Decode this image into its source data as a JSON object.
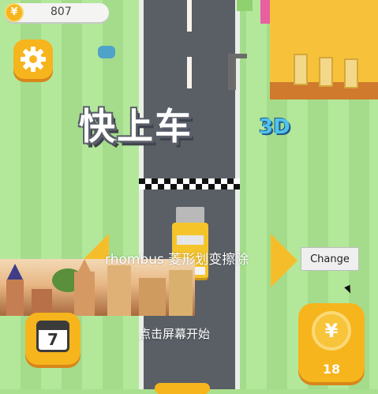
{
  "hud": {
    "coin_symbol": "¥",
    "coin_count": "807"
  },
  "title": {
    "main": "快上车",
    "suffix": "3D"
  },
  "overlay": {
    "caption": "rhombus 菱形划变擦除",
    "change_label": "Change"
  },
  "bottom": {
    "calendar_day": "7",
    "start_hint": "点击屏幕开始",
    "coin_symbol": "¥",
    "coin_reward": "18"
  },
  "icons": {
    "settings": "gear-icon",
    "coin": "coin-icon",
    "calendar": "calendar-icon",
    "left_arrow": "left-arrow-icon",
    "right_arrow": "right-arrow-icon"
  },
  "colors": {
    "accent": "#f6b51c",
    "road": "#5a5f66",
    "grass": "#b3e89b",
    "car": "#f5c42b",
    "title_3d": "#4fc3ef"
  }
}
